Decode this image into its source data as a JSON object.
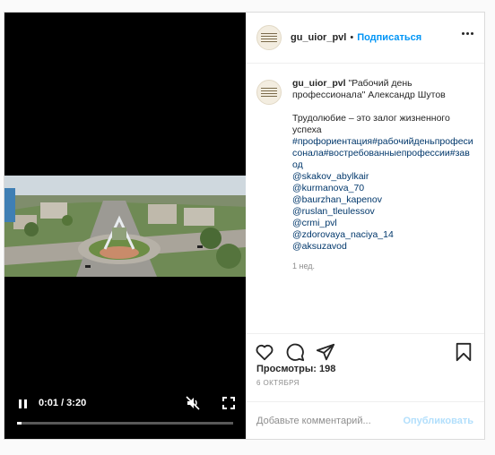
{
  "post": {
    "username": "gu_uior_pvl",
    "follow_label": "Подписаться",
    "separator": "•",
    "caption_title": "\"Рабочий день профессионала\" Александр Шутов",
    "caption_text": "Трудолюбие – это залог жизненного успеха",
    "hashtags": "#профориентация#рабочийденьпрофесисонала#востребованныепрофессии#завод",
    "mentions": [
      "@skakov_abylkair",
      "@kurmanova_70",
      "@baurzhan_kapenov",
      "@ruslan_tleulessov",
      "@crmi_pvl",
      "@zdorovaya_naciya_14",
      "@aksuzavod"
    ],
    "time_ago": "1 нед.",
    "views_label": "Просмотры: 198",
    "date": "6 ОКТЯБРЯ",
    "comment_placeholder": "Добавьте комментарий...",
    "publish_label": "Опубликовать"
  },
  "video": {
    "time_display": "0:01 / 3:20",
    "progress": 0.02,
    "state": "playing",
    "muted": true
  },
  "icons": {
    "like": "heart-icon",
    "comment": "comment-icon",
    "share": "share-icon",
    "save": "bookmark-icon",
    "more": "more-icon"
  },
  "colors": {
    "link": "#0095f6",
    "hashtag": "#00376b",
    "muted_text": "#8e8e8e"
  }
}
